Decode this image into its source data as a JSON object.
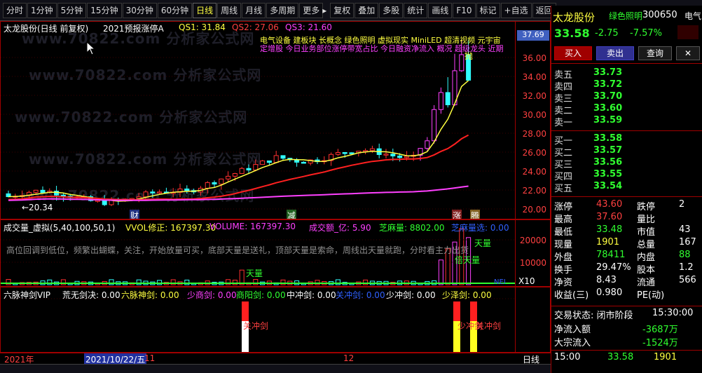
{
  "toolbar": {
    "items": [
      "分时",
      "1分钟",
      "5分钟",
      "15分钟",
      "30分钟",
      "60分钟",
      "日线",
      "周线",
      "月线",
      "多周期",
      "更多",
      "复权",
      "叠加",
      "多股",
      "统计",
      "画线",
      "F10",
      "标记",
      "+自选",
      "返回"
    ],
    "active": "日线",
    "more_arrow": "▸"
  },
  "chart": {
    "title": "太龙股份(日线 前复权)",
    "indicator_name": "2021预报涨停A",
    "qs1": "QS1: 31.84",
    "qs2": "QS2: 27.06",
    "qs3": "QS3: 21.60",
    "concept_line1": "电气设备 建板块 长概念 绿色照明 虚拟现实 MiniLED 超清视频 元宇宙",
    "concept_line2": "定增股 今日业务部位涨停带宽占比 今日融资净流入 概况 超级龙头 近期",
    "price_axis": [
      "37.69",
      "36.00",
      "34.00",
      "32.00",
      "30.00",
      "28.00",
      "26.00",
      "24.00",
      "22.00",
      "20.00"
    ],
    "low_label": "←20.34",
    "markers": [
      "财",
      "减",
      "涨",
      "腾"
    ],
    "hint_label": "抛",
    "watermark": "www.70822.com    分析家公式网"
  },
  "volume_panel": {
    "title": "成交量_虚拟(5,40,100,50,1)",
    "vvol": "VVOL修正: 167397.30",
    "volume": "VOLUME: 167397.30",
    "amount": "成交额_亿: 5.90",
    "zhima": "芝麻量: 8802.00",
    "zhima2": "芝麻量选: 0.00",
    "note": "高位回调到低位，频繁出蝴蝶，关注，开始放量可买，底部天量是送礼，顶部天量是索命，周线出天量就跑，分时看主力出货",
    "axis": [
      "20000",
      "10000"
    ],
    "unit": "X10",
    "tianliang": "天量",
    "beitianliang": "倍天量",
    "tag_right": "NEI"
  },
  "sword_panel": {
    "title": "六脉神剑VIP",
    "items": [
      "荒无剑决: 0.00",
      "六脉神剑: 0.00",
      "少商剑: 0.00",
      "商阳剑: 0.00",
      "中冲剑: 0.00",
      "关冲剑: 0.00",
      "少冲剑: 0.00",
      "少泽剑: 0.00"
    ],
    "label_a": "关冲剑",
    "label_b": "少冲剑"
  },
  "bottom_bar": {
    "year": "2021年",
    "date": "2021/10/22/五",
    "tick_a": "11",
    "tick_b": "12",
    "period": "日线"
  },
  "quote": {
    "name": "太龙股份",
    "concept": "绿色照明",
    "code": "300650",
    "extra": "电气",
    "price": "33.58",
    "change": "-2.75",
    "pct": "-7.57%",
    "buy_btn": "买入",
    "sell_btn": "卖出",
    "query_btn": "查询",
    "asks": [
      {
        "n": "卖五",
        "p": "33.73"
      },
      {
        "n": "卖四",
        "p": "33.72"
      },
      {
        "n": "卖三",
        "p": "33.70"
      },
      {
        "n": "卖二",
        "p": "33.60"
      },
      {
        "n": "卖一",
        "p": "33.59"
      }
    ],
    "bids": [
      {
        "n": "买一",
        "p": "33.58"
      },
      {
        "n": "买二",
        "p": "33.57"
      },
      {
        "n": "买三",
        "p": "33.56"
      },
      {
        "n": "买四",
        "p": "33.55"
      },
      {
        "n": "买五",
        "p": "33.54"
      }
    ],
    "stats": [
      {
        "a": "涨停",
        "av": "43.60",
        "b": "跌停",
        "bv": "2"
      },
      {
        "a": "最高",
        "av": "37.60",
        "b": "量比",
        "bv": ""
      },
      {
        "a": "最低",
        "av": "33.48",
        "b": "市值",
        "bv": "43"
      },
      {
        "a": "现量",
        "av": "1901",
        "b": "总量",
        "bv": "167"
      },
      {
        "a": "外盘",
        "av": "78411",
        "b": "内盘",
        "bv": "88"
      },
      {
        "a": "换手",
        "av": "29.47%",
        "b": "股本",
        "bv": "1.2"
      },
      {
        "a": "净资",
        "av": "8.43",
        "b": "流通",
        "bv": "566"
      },
      {
        "a": "收益(三)",
        "av": "0.980",
        "b": "PE(动)",
        "bv": ""
      }
    ],
    "trade_status": "交易状态: 闭市阶段",
    "trade_time": "15:30:00",
    "net_inflow_label": "净流入额",
    "net_inflow": "-3687万",
    "big_inflow_label": "大宗流入",
    "big_inflow": "-1524万",
    "tick_time": "15:00",
    "tick_price": "33.58",
    "tick_vol": "1901"
  },
  "colors": {
    "up": "#ff3030",
    "down": "#30ffff",
    "yellow": "#ffff40",
    "green": "#30ff30",
    "magenta": "#ff40ff",
    "frame": "#a00000"
  }
}
